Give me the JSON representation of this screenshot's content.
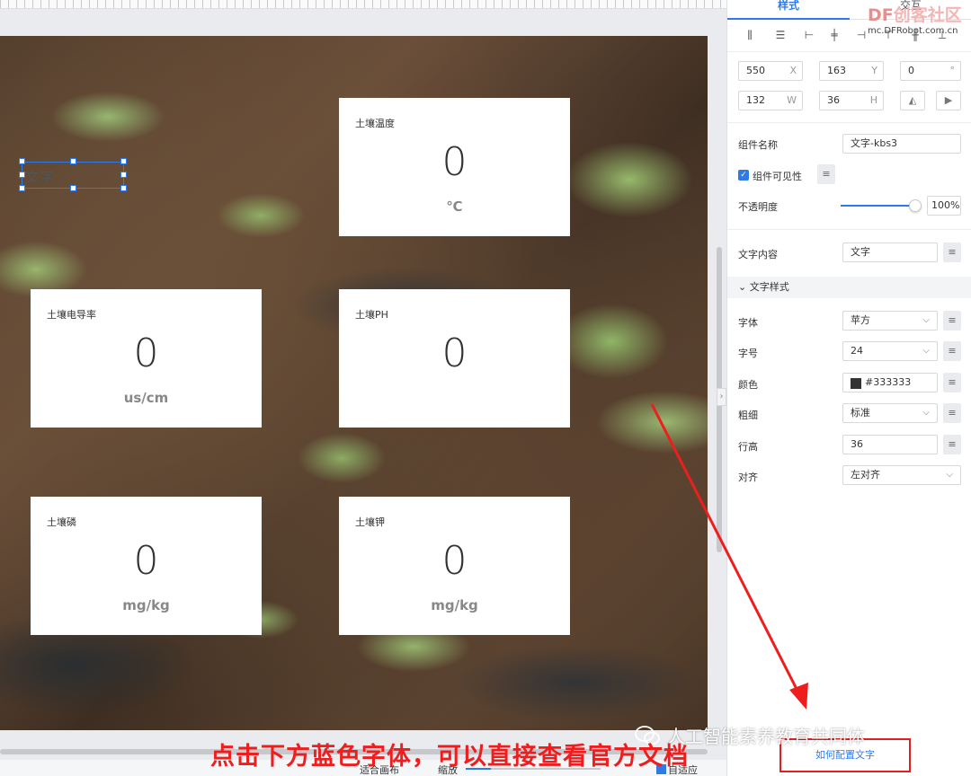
{
  "canvas": {
    "cards": [
      {
        "title": "土壤温度",
        "value": "0",
        "unit": "℃"
      },
      {
        "title": "土壤电导率",
        "value": "0",
        "unit": "us/cm"
      },
      {
        "title": "土壤PH",
        "value": "0",
        "unit": ""
      },
      {
        "title": "土壤磷",
        "value": "0",
        "unit": "mg/kg"
      },
      {
        "title": "土壤钾",
        "value": "0",
        "unit": "mg/kg"
      }
    ],
    "selected_text": "文字"
  },
  "bottom_bar": {
    "fit_canvas": "适合画布",
    "zoom": "缩放",
    "auto_fit": "自适应"
  },
  "panel": {
    "tabs": {
      "style": "样式",
      "data": "交互"
    },
    "position": {
      "x": "550",
      "x_label": "X",
      "y": "163",
      "y_label": "Y",
      "rotation": "0",
      "rotation_unit": "°"
    },
    "size": {
      "w": "132",
      "w_label": "W",
      "h": "36",
      "h_label": "H"
    },
    "component_name": {
      "label": "组件名称",
      "value": "文字-kbs3"
    },
    "visible": {
      "label": "组件可见性",
      "checked": true
    },
    "opacity": {
      "label": "不透明度",
      "value": "100%",
      "level": 1.0
    },
    "text_content": {
      "label": "文字内容",
      "value": "文字"
    },
    "text_style_header": "文字样式",
    "font": {
      "label": "字体",
      "value": "苹方"
    },
    "font_size": {
      "label": "字号",
      "value": "24"
    },
    "color": {
      "label": "颜色",
      "value": "#333333"
    },
    "weight": {
      "label": "粗细",
      "value": "标准"
    },
    "line_height": {
      "label": "行高",
      "value": "36"
    },
    "align": {
      "label": "对齐",
      "value": "左对齐"
    },
    "help_link": "如何配置文字"
  },
  "overlay": {
    "logo_df": "DF",
    "logo_text": "创客社区",
    "logo_url": "mc.DFRobot.com.cn",
    "caption": "点击下方蓝色字体，可以直接查看官方文档",
    "wechat": "人工智能素养教育共同体"
  },
  "colors": {
    "accent": "#2e7be8",
    "annotation": "#ee1e1e"
  }
}
